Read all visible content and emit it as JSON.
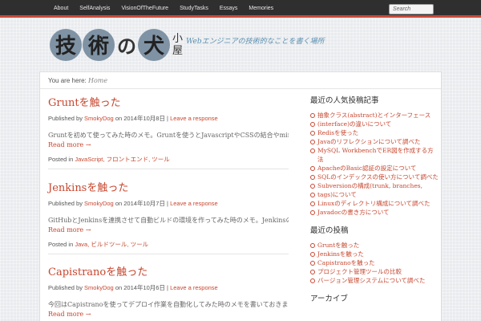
{
  "nav": {
    "items": [
      "About",
      "SelfAnalysis",
      "VisionOfTheFuture",
      "StudyTasks",
      "Essays",
      "Memories"
    ],
    "search_placeholder": "Search"
  },
  "header": {
    "logo_chars": {
      "c1": "技",
      "c2": "術",
      "c3": "の",
      "c4": "犬",
      "c5": "小",
      "c6": "屋"
    },
    "tagline": "Webエンジニアの技術的なことを書く場所"
  },
  "breadcrumb": {
    "label": "You are here:",
    "current": "Home"
  },
  "posts": [
    {
      "title": "Gruntを触った",
      "byline_prefix": "Published by",
      "author": "SmokyDog",
      "date": "on 2014年10月8日 |",
      "response": "Leave a response",
      "excerpt": "Gruntを初めて使ってみた時のメモ。Gruntを使うとJavascriptやCSSの結合やminifyなどの作業を自動化できる。",
      "readmore": "Read more →",
      "posted_in": "Posted in",
      "categories": [
        "JavaScript,",
        "フロントエンド,",
        "ツール"
      ]
    },
    {
      "title": "Jenkinsを触った",
      "byline_prefix": "Published by",
      "author": "SmokyDog",
      "date": "on 2014年10月7日 |",
      "response": "Leave a response",
      "excerpt": "GitHubとJenkinsを連携させて自動ビルドの環境を作ってみた時のメモ。Jenkinsのインストールから Jenkins",
      "readmore": "Read more →",
      "posted_in": "Posted in",
      "categories": [
        "Java,",
        "ビルドツール,",
        "ツール"
      ]
    },
    {
      "title": "Capistranoを触った",
      "byline_prefix": "Published by",
      "author": "SmokyDog",
      "date": "on 2014年10月6日 |",
      "response": "Leave a response",
      "excerpt": "今回はCapistranoを使ってデプロイ作業を自動化してみた時のメモを書いておきます。 ※ Capistrano",
      "readmore": "Read more →"
    }
  ],
  "sidebar": {
    "recent_title": "最近の人気投稿記事",
    "recent": [
      "抽象クラス(abstract)とインターフェース",
      "(interface)の違いについて",
      "Redisを使った",
      "Javaのリフレクションについて調べた",
      "MySQL WorkbenchでER図を作成する方法",
      "ApacheのBasic認証の設定について",
      "SQLのインデックスの使い方について調べた",
      "Subversionの構成(trunk, branches,",
      "tags)について",
      "Linuxのディレクトリ構成について調べた",
      "Javadocの書き方について"
    ],
    "posts_title": "最近の投稿",
    "posts": [
      "Gruntを触った",
      "Jenkinsを触った",
      "Capistranoを触った",
      "プロジェクト管理ツールの比較",
      "バージョン管理システムについて調べた"
    ],
    "archive_title": "アーカイブ"
  }
}
